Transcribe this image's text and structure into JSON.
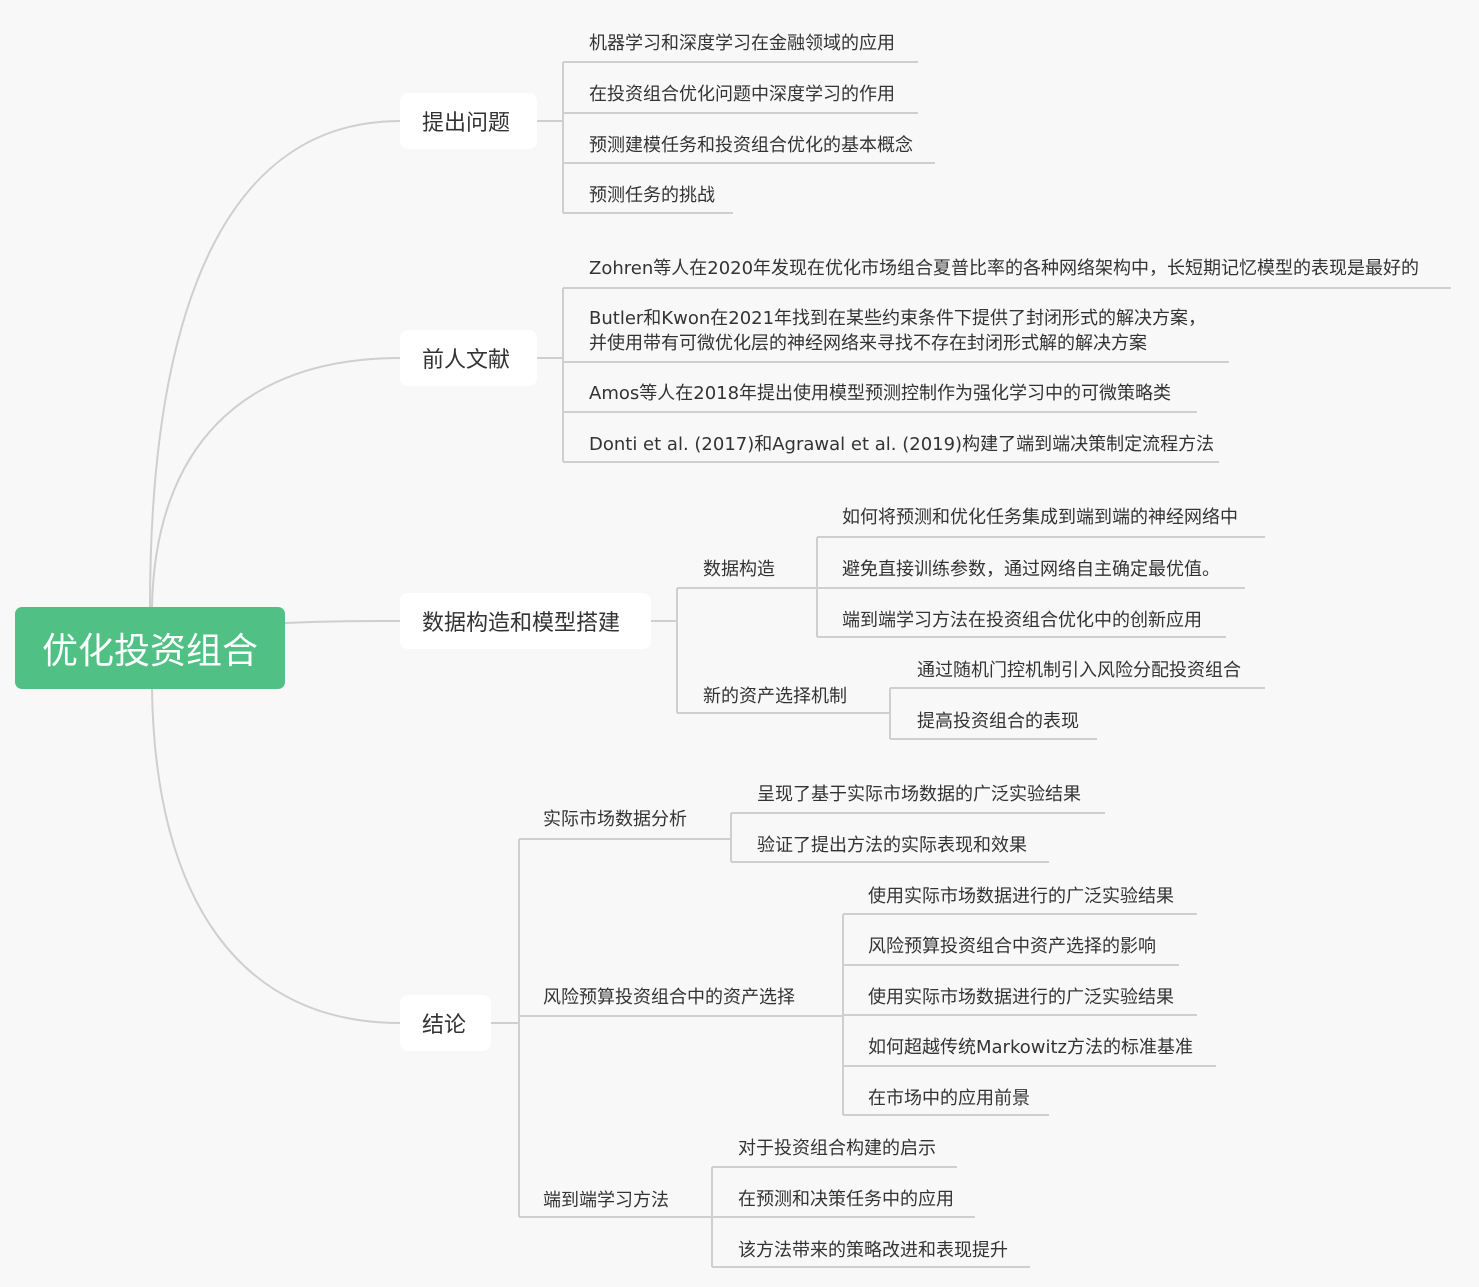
{
  "root": {
    "label": "优化投资组合"
  },
  "branches": [
    {
      "label": "提出问题",
      "children": [
        {
          "label": "机器学习和深度学习在金融领域的应用"
        },
        {
          "label": "在投资组合优化问题中深度学习的作用"
        },
        {
          "label": "预测建模任务和投资组合优化的基本概念"
        },
        {
          "label": "预测任务的挑战"
        }
      ]
    },
    {
      "label": "前人文献",
      "children": [
        {
          "label": "Zohren等人在2020年发现在优化市场组合夏普比率的各种网络架构中，长短期记忆模型的表现是最好的"
        },
        {
          "label": "Butler和Kwon在2021年找到在某些约束条件下提供了封闭形式的解决方案，\n并使用带有可微优化层的神经网络来寻找不存在封闭形式解的解决方案"
        },
        {
          "label": "Amos等人在2018年提出使用模型预测控制作为强化学习中的可微策略类"
        },
        {
          "label": "Donti et al. (2017)和Agrawal et al. (2019)构建了端到端决策制定流程方法"
        }
      ]
    },
    {
      "label": "数据构造和模型搭建",
      "children": [
        {
          "label": "数据构造",
          "children": [
            {
              "label": "如何将预测和优化任务集成到端到端的神经网络中"
            },
            {
              "label": "避免直接训练参数，通过网络自主确定最优值。"
            },
            {
              "label": "端到端学习方法在投资组合优化中的创新应用"
            }
          ]
        },
        {
          "label": "新的资产选择机制",
          "children": [
            {
              "label": "通过随机门控机制引入风险分配投资组合"
            },
            {
              "label": "提高投资组合的表现"
            }
          ]
        }
      ]
    },
    {
      "label": "结论",
      "children": [
        {
          "label": "实际市场数据分析",
          "children": [
            {
              "label": "呈现了基于实际市场数据的广泛实验结果"
            },
            {
              "label": "验证了提出方法的实际表现和效果"
            }
          ]
        },
        {
          "label": "风险预算投资组合中的资产选择",
          "children": [
            {
              "label": "使用实际市场数据进行的广泛实验结果"
            },
            {
              "label": "风险预算投资组合中资产选择的影响"
            },
            {
              "label": "使用实际市场数据进行的广泛实验结果"
            },
            {
              "label": "如何超越传统Markowitz方法的标准基准"
            },
            {
              "label": "在市场中的应用前景"
            }
          ]
        },
        {
          "label": "端到端学习方法",
          "children": [
            {
              "label": "对于投资组合构建的启示"
            },
            {
              "label": "在预测和决策任务中的应用"
            },
            {
              "label": "该方法带来的策略改进和表现提升"
            }
          ]
        }
      ]
    }
  ]
}
